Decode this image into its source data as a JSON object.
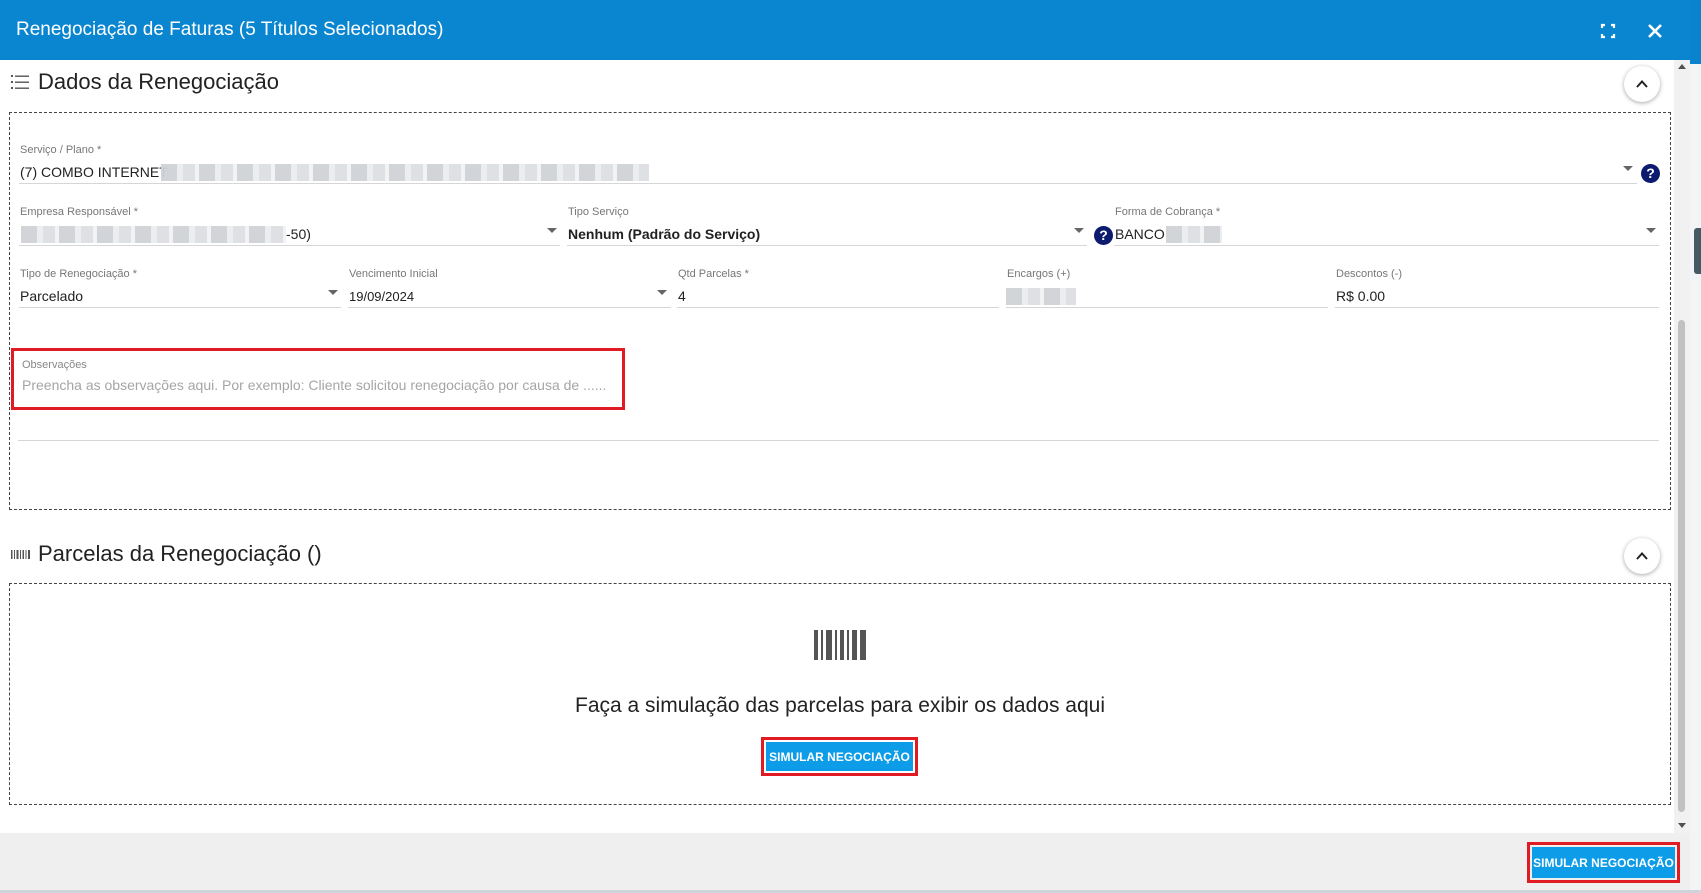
{
  "modal": {
    "title": "Renegociação de Faturas (5 Títulos Selecionados)"
  },
  "dados": {
    "title": "Dados da Renegociação",
    "servico": {
      "label": "Serviço / Plano *",
      "value": "(7) COMBO INTERNET"
    },
    "empresa": {
      "label": "Empresa Responsável *",
      "value_suffix": "-50)"
    },
    "tipo_servico": {
      "label": "Tipo Serviço",
      "value": "Nenhum (Padrão do Serviço)"
    },
    "forma_cobranca": {
      "label": "Forma de Cobrança *",
      "value": "BANCO"
    },
    "tipo_renegociacao": {
      "label": "Tipo de Renegociação *",
      "value": "Parcelado"
    },
    "vencimento": {
      "label": "Vencimento Inicial",
      "value": "19/09/2024"
    },
    "qtd_parcelas": {
      "label": "Qtd Parcelas *",
      "value": "4"
    },
    "encargos": {
      "label": "Encargos (+)"
    },
    "descontos": {
      "label": "Descontos (-)",
      "value": "R$ 0.00"
    },
    "observacoes": {
      "label": "Observações",
      "placeholder": "Preencha as observações aqui. Por exemplo: Cliente solicitou renegociação por causa de ......"
    }
  },
  "parcelas": {
    "title": "Parcelas da Renegociação ()",
    "empty_text": "Faça a simulação das parcelas para exibir os dados aqui",
    "simulate_label": "SIMULAR NEGOCIAÇÃO"
  },
  "footer": {
    "simulate_label": "SIMULAR NEGOCIAÇÃO"
  },
  "colors": {
    "header": "#0a86d1",
    "button": "#0d9ce8",
    "highlight": "#e01b24",
    "help": "#0d1b6e"
  },
  "icons": {
    "list": "list-icon",
    "barcode": "barcode-icon",
    "fullscreen": "fullscreen-icon",
    "close": "close-icon",
    "chevron": "chevron-up-icon",
    "help": "help-icon"
  }
}
